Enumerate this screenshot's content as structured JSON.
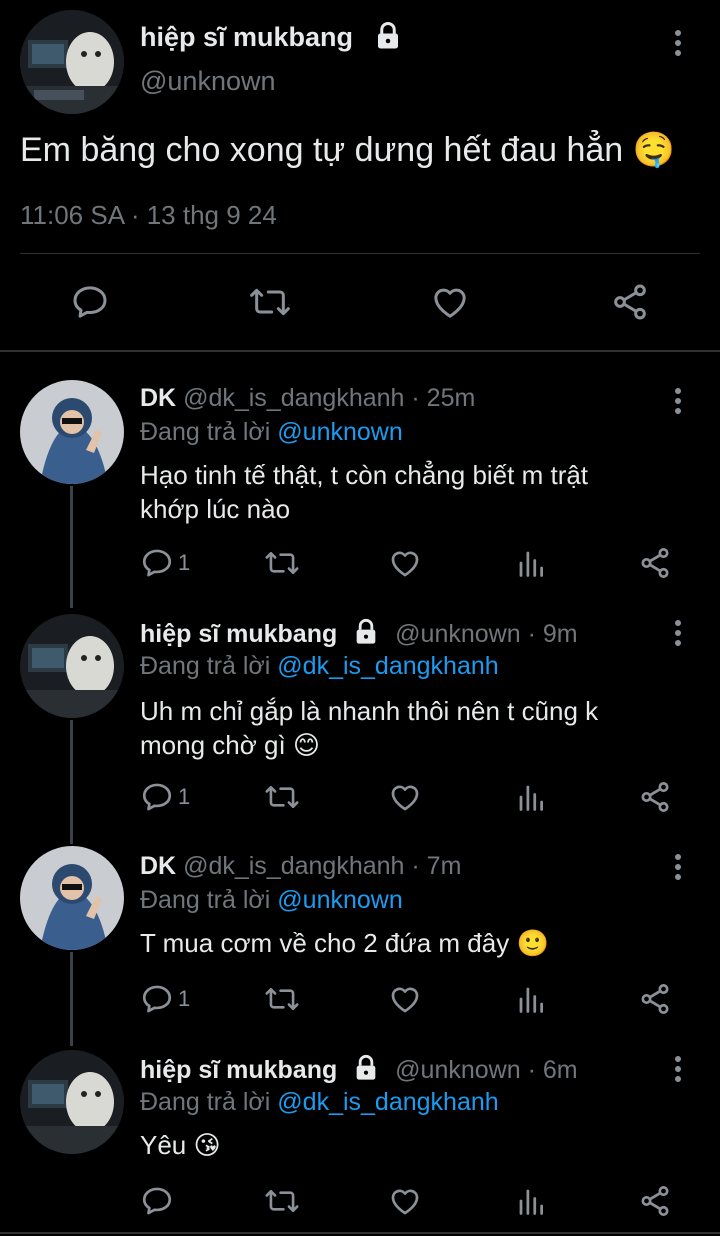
{
  "main_tweet": {
    "display_name": "hiệp sĩ mukbang",
    "handle": "@unknown",
    "text": "Em băng cho xong tự dưng hết đau hẳn 🤤",
    "timestamp": "11:06 SA · 13 thg 9 24",
    "actions": [
      "reply",
      "retweet",
      "like",
      "share"
    ]
  },
  "replies": [
    {
      "display_name": "DK",
      "handle": "@dk_is_dangkhanh",
      "time": "· 25m",
      "replying_prefix": "Đang trả lời ",
      "replying_to": "@unknown",
      "text_lines": [
        "Hạo tinh tế thật, t còn chẳng biết m trật",
        "khớp lúc nào"
      ],
      "reply_count": "1"
    },
    {
      "display_name": "hiệp sĩ mukbang",
      "handle": "@unknown",
      "time": "· 9m",
      "replying_prefix": "Đang trả lời ",
      "replying_to": "@dk_is_dangkhanh",
      "text_lines": [
        "Uh m chỉ gắp là nhanh thôi nên t cũng k",
        "mong chờ gì 😊"
      ],
      "reply_count": "1"
    },
    {
      "display_name": "DK",
      "handle": "@dk_is_dangkhanh",
      "time": "· 7m",
      "replying_prefix": "Đang trả lời ",
      "replying_to": "@unknown",
      "text_lines": [
        "T mua cơm về cho 2 đứa m đây 🙂"
      ],
      "reply_count": "1"
    },
    {
      "display_name": "hiệp sĩ mukbang",
      "handle": "@unknown",
      "time": "· 6m",
      "replying_prefix": "Đang trả lời ",
      "replying_to": "@dk_is_dangkhanh",
      "text_lines": [
        "Yêu 😘"
      ],
      "reply_count": ""
    }
  ],
  "colors": {
    "background": "#000000",
    "text": "#e7e9ea",
    "muted": "#71767b",
    "link": "#1d9bf0",
    "divider": "#2f3336"
  }
}
